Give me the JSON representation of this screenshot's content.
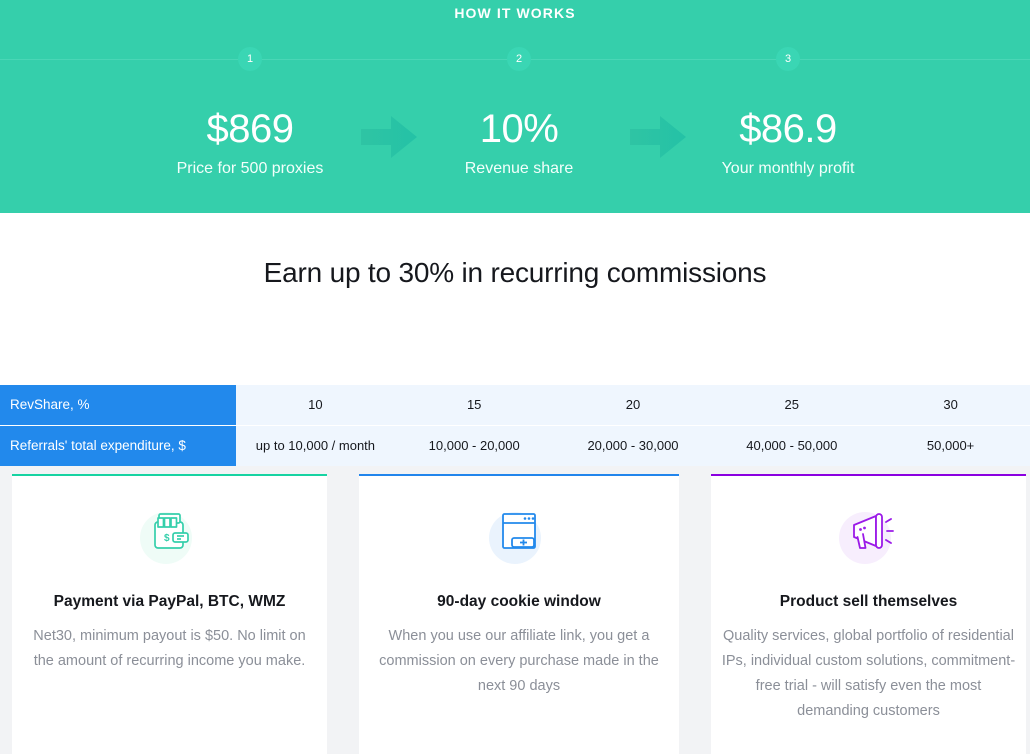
{
  "hero": {
    "title": "HOW IT WORKS",
    "accent": "#35cfab",
    "badge_color": "#3ad6b4",
    "steps": [
      {
        "badge": "1",
        "value": "$869",
        "label": "Price for 500 proxies"
      },
      {
        "badge": "2",
        "value": "10%",
        "label": "Revenue share"
      },
      {
        "badge": "3",
        "value": "$86.9",
        "label": "Your monthly profit"
      }
    ],
    "arrow_icon": "arrow-right-icon"
  },
  "section": {
    "heading": "Earn up to 30% in recurring commissions"
  },
  "rate_table": {
    "header_color": "#2289ec",
    "body_color": "#eff6fe",
    "rows": [
      {
        "label": "RevShare, %",
        "cells": [
          "10",
          "15",
          "20",
          "25",
          "30"
        ]
      },
      {
        "label": "Referrals' total expenditure, $",
        "cells": [
          "up to 10,000 / month",
          "10,000 - 20,000",
          "20,000 - 30,000",
          "40,000 - 50,000",
          "50,000+"
        ]
      }
    ]
  },
  "cards": [
    {
      "accent": "#17d3a2",
      "icon": "wallet-icon",
      "title": "Payment via PayPal, BTC, WMZ",
      "text": "Net30, minimum payout is $50. No limit on the amount of recurring income you make."
    },
    {
      "accent": "#2285ec",
      "icon": "browser-window-icon",
      "title": "90-day cookie window",
      "text": "When you use our affiliate link, you get a commission on every purchase made in the next 90 days"
    },
    {
      "accent": "#8b00e0",
      "icon": "megaphone-icon",
      "title": "Product sell themselves",
      "text": "Quality services, global portfolio of residential IPs, individual custom solutions, commitment-free trial - will satisfy even the most demanding customers"
    }
  ]
}
